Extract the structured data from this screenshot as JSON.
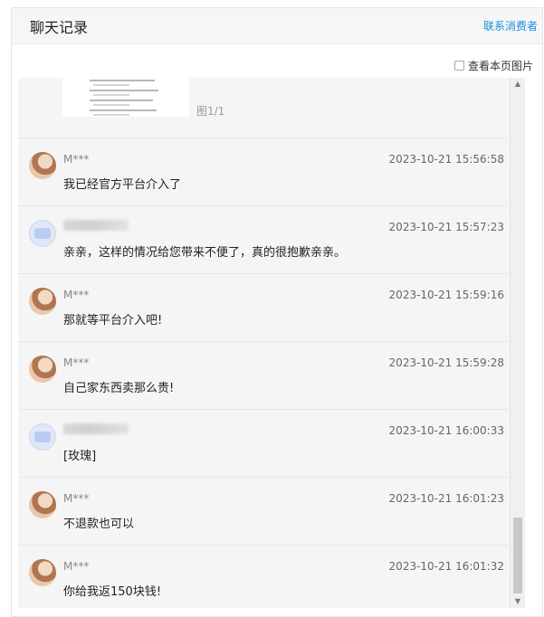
{
  "header": {
    "title": "聊天记录",
    "contact_link": "联系消费者"
  },
  "toolbar": {
    "view_images_label": "查看本页图片"
  },
  "top_image": {
    "count_label": "图1/1"
  },
  "messages": [
    {
      "sender": "M***",
      "time": "2023-10-21 15:56:58",
      "text": "我已经官方平台介入了"
    },
    {
      "sender": "",
      "time": "2023-10-21 15:57:23",
      "text": "亲亲，这样的情况给您带来不便了，真的很抱歉亲亲。"
    },
    {
      "sender": "M***",
      "time": "2023-10-21 15:59:16",
      "text": "那就等平台介入吧!"
    },
    {
      "sender": "M***",
      "time": "2023-10-21 15:59:28",
      "text": "自己家东西卖那么贵!"
    },
    {
      "sender": "",
      "time": "2023-10-21 16:00:33",
      "text": "[玫瑰]"
    },
    {
      "sender": "M***",
      "time": "2023-10-21 16:01:23",
      "text": "不退款也可以"
    },
    {
      "sender": "M***",
      "time": "2023-10-21 16:01:32",
      "text": "你给我返150块钱!"
    }
  ],
  "scrollbar": {
    "up_icon": "triangle-up-icon",
    "down_icon": "triangle-down-icon"
  }
}
